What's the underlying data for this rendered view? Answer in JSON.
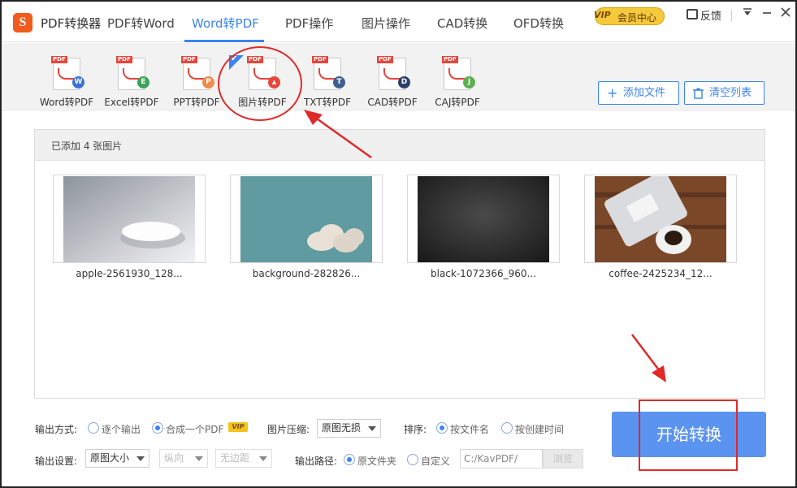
{
  "app": {
    "logo_text": "S",
    "title": "PDF转换器"
  },
  "nav_tabs": [
    {
      "label": "PDF转Word"
    },
    {
      "label": "Word转PDF"
    },
    {
      "label": "PDF操作"
    },
    {
      "label": "图片操作"
    },
    {
      "label": "CAD转换"
    },
    {
      "label": "OFD转换"
    }
  ],
  "header": {
    "vip_badge_mark": "VIP",
    "vip_label": "会员中心",
    "feedback_label": "反馈"
  },
  "tools": [
    {
      "label": "Word转PDF",
      "badge": "W",
      "badge_color": "#3b6fd8"
    },
    {
      "label": "Excel转PDF",
      "badge": "E",
      "badge_color": "#3aa35b"
    },
    {
      "label": "PPT转PDF",
      "badge": "P",
      "badge_color": "#f08a4b"
    },
    {
      "label": "图片转PDF",
      "badge": "▲",
      "badge_color": "#e8453c"
    },
    {
      "label": "TXT转PDF",
      "badge": "T",
      "badge_color": "#3e5f8f"
    },
    {
      "label": "CAD转PDF",
      "badge": "D",
      "badge_color": "#2c3e6b"
    },
    {
      "label": "CAJ转PDF",
      "badge": "J",
      "badge_color": "#5bb04f"
    }
  ],
  "toolbar_buttons": {
    "add_file": "添加文件",
    "clear_list": "清空列表"
  },
  "file_panel": {
    "count_text": "已添加 4 张图片",
    "files": [
      {
        "name": "apple-2561930_128..."
      },
      {
        "name": "background-282826..."
      },
      {
        "name": "black-1072366_960..."
      },
      {
        "name": "coffee-2425234_12..."
      }
    ]
  },
  "options": {
    "output_mode_label": "输出方式:",
    "output_mode_one_by_one": "逐个输出",
    "output_mode_merge": "合成一个PDF",
    "vip_tag": "VIP",
    "compress_label": "图片压缩:",
    "compress_value": "原图无损",
    "sort_label": "排序:",
    "sort_by_name": "按文件名",
    "sort_by_created": "按创建时间",
    "output_settings_label": "输出设置:",
    "size_value": "原图大小",
    "orientation_value": "纵向",
    "margin_value": "无边距",
    "output_path_label": "输出路径:",
    "path_source_folder": "原文件夹",
    "path_custom": "自定义",
    "path_value": "C:/KavPDF/",
    "browse_label": "浏览"
  },
  "start_button": "开始转换",
  "colors": {
    "accent": "#3c83f0",
    "annotation": "#e02a2a",
    "start_button": "#5b93f0"
  }
}
